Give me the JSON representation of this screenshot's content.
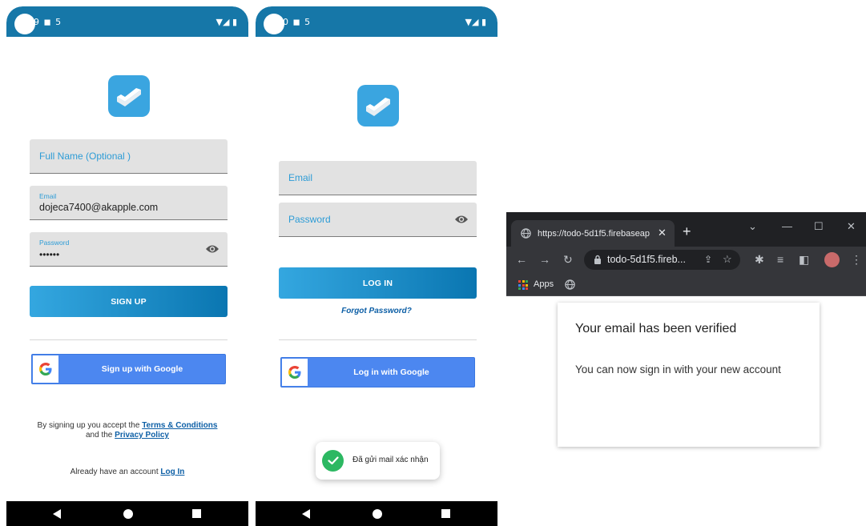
{
  "status_bar": {
    "left_text_1": "9 ◼ 5",
    "left_text_2": "0 ◼ 5",
    "right_text": "▼◢ ▮"
  },
  "signup": {
    "full_name_placeholder": "Full Name (Optional )",
    "email_label": "Email",
    "email_value": "dojeca7400@akapple.com",
    "password_label": "Password",
    "password_value": "••••••",
    "signup_button": "SIGN UP",
    "google_button": "Sign up with Google",
    "terms_prefix": "By signing up you accept the ",
    "terms_link": "Terms & Conditions",
    "terms_middle": "and the ",
    "privacy_link": "Privacy Policy",
    "account_prefix": "Already have an account ",
    "login_link": "Log In"
  },
  "login": {
    "email_placeholder": "Email",
    "password_placeholder": "Password",
    "login_button": "LOG IN",
    "forgot_link": "Forgot Password?",
    "google_button": "Log in with Google",
    "toast_text": "Đã gửi mail xác nhận"
  },
  "browser": {
    "tab_title": "https://todo-5d1f5.firebaseapp",
    "tab_close": "✕",
    "new_tab": "+",
    "url": "todo-5d1f5.fireb...",
    "bookmark_apps": "Apps",
    "card_title": "Your email has been verified",
    "card_message": "You can now sign in with your new account",
    "apps_colors": [
      "#ea4335",
      "#fbbc05",
      "#34a853",
      "#4285f4",
      "#ea4335",
      "#fbbc05",
      "#34a853",
      "#4285f4",
      "#ea4335"
    ]
  },
  "colors": {
    "brand_blue": "#1677a8",
    "gradient_start": "#34a7e0",
    "gradient_end": "#0a76b1",
    "google_blue": "#4c87f0",
    "link_blue": "#0d5fa6",
    "success_green": "#2cb862"
  }
}
